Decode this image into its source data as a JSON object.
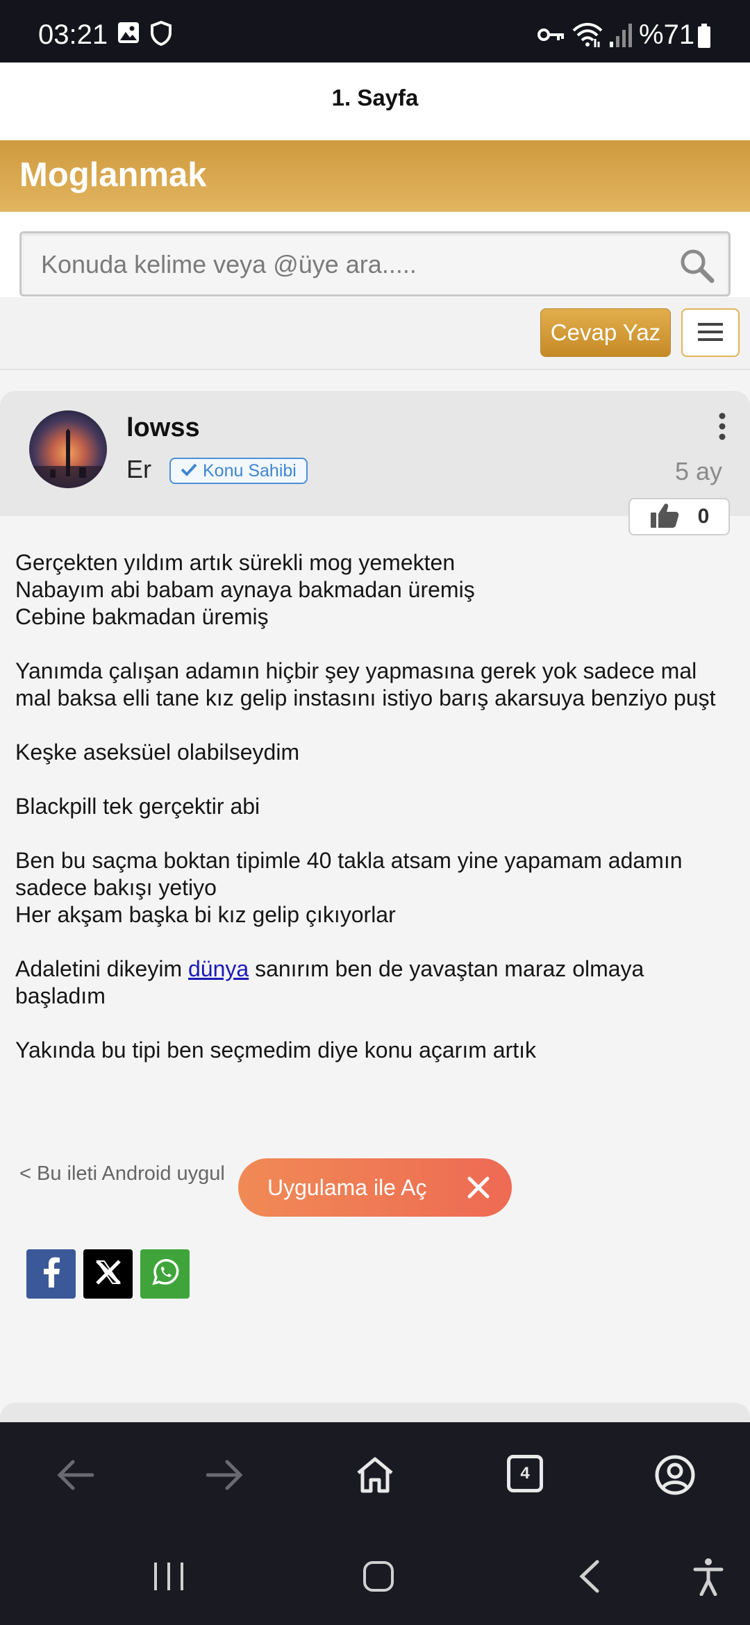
{
  "status_bar": {
    "time": "03:21",
    "battery": "%71",
    "icons": [
      "image-icon",
      "shield-icon",
      "key-icon",
      "wifi-icon",
      "signal-icon",
      "battery-icon"
    ]
  },
  "page": {
    "title": "1. Sayfa"
  },
  "forum": {
    "name": "Moglanmak",
    "accent_color": "#d9a54a"
  },
  "search": {
    "placeholder": "Konuda kelime veya @üye ara....."
  },
  "toolbar": {
    "reply_label": "Cevap Yaz"
  },
  "post": {
    "username": "lowss",
    "rank": "Er",
    "badge": "Konu Sahibi",
    "time_ago": "5 ay",
    "likes": "0",
    "paragraphs": [
      {
        "lines": [
          "Gerçekten yıldım artık sürekli mog yemekten",
          "Nabayım abi babam aynaya bakmadan üremiş",
          "Cebine bakmadan üremiş"
        ]
      },
      {
        "lines": [
          "Yanımda çalışan adamın hiçbir şey yapmasına gerek yok sadece mal mal baksa elli tane kız gelip instasını istiyo barış akarsuya benziyo puşt"
        ]
      },
      {
        "lines": [
          "Keşke aseksüel olabilseydim"
        ]
      },
      {
        "lines": [
          "Blackpill tek gerçektir abi"
        ]
      },
      {
        "lines": [
          "Ben bu saçma boktan tipimle 40 takla atsam yine yapamam adamın sadece bakışı yetiyo",
          "Her akşam başka bi kız gelip çıkıyorlar"
        ]
      }
    ],
    "link_para": {
      "before": "Adaletini dikeyim ",
      "link": "dünya",
      "after": " sanırım ben de yavaştan maraz olmaya başladım"
    },
    "last_para": "Yakında bu tipi ben seçmedim diye konu açarım artık",
    "footer_note": "< Bu ileti Android uygul"
  },
  "open_app": {
    "label": "Uygulama ile Aç"
  },
  "share": {
    "buttons": [
      "facebook-icon",
      "x-icon",
      "whatsapp-icon"
    ]
  },
  "browser_bar": {
    "tab_count": "4"
  }
}
